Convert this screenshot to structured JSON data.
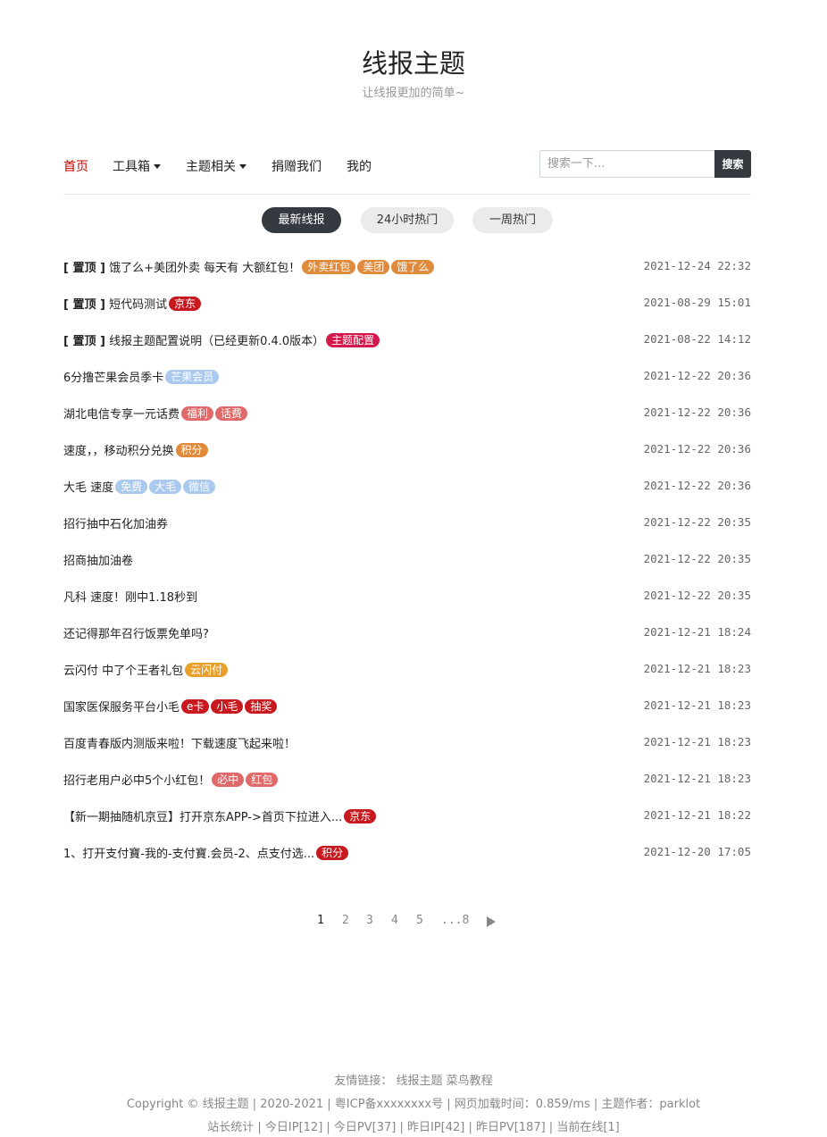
{
  "site": {
    "title": "线报主题",
    "subtitle": "让线报更加的简单~"
  },
  "nav": {
    "items": [
      {
        "label": "首页",
        "active": true,
        "dropdown": false
      },
      {
        "label": "工具箱",
        "active": false,
        "dropdown": true
      },
      {
        "label": "主题相关",
        "active": false,
        "dropdown": true
      },
      {
        "label": "捐赠我们",
        "active": false,
        "dropdown": false
      },
      {
        "label": "我的",
        "active": false,
        "dropdown": false
      }
    ],
    "search_placeholder": "搜索一下...",
    "search_button": "搜索"
  },
  "tabs": [
    {
      "label": "最新线报",
      "active": true
    },
    {
      "label": "24小时热门",
      "active": false
    },
    {
      "label": "一周热门",
      "active": false
    }
  ],
  "posts": [
    {
      "pin": "[ 置顶 ]",
      "title": "饿了么+美团外卖 每天有 大额红包！",
      "tags": [
        {
          "text": "外卖红包",
          "color": "#e08a3c"
        },
        {
          "text": "美团",
          "color": "#e08a3c"
        },
        {
          "text": "饿了么",
          "color": "#e08a3c"
        }
      ],
      "time": "2021-12-24 22:32"
    },
    {
      "pin": "[ 置顶 ]",
      "title": "短代码测试",
      "tags": [
        {
          "text": "京东",
          "color": "#c8191f"
        }
      ],
      "time": "2021-08-29 15:01"
    },
    {
      "pin": "[ 置顶 ]",
      "title": "线报主题配置说明（已经更新0.4.0版本）",
      "tags": [
        {
          "text": "主题配置",
          "color": "#d4174c"
        }
      ],
      "time": "2021-08-22 14:12"
    },
    {
      "pin": "",
      "title": "6分撸芒果会员季卡",
      "tags": [
        {
          "text": "芒果会员",
          "color": "#a9c9ef"
        }
      ],
      "time": "2021-12-22 20:36"
    },
    {
      "pin": "",
      "title": "湖北电信专享一元话费",
      "tags": [
        {
          "text": "福利",
          "color": "#e06a6a"
        },
        {
          "text": "话费",
          "color": "#e06a6a"
        }
      ],
      "time": "2021-12-22 20:36"
    },
    {
      "pin": "",
      "title": "速度，，移动积分兑换",
      "tags": [
        {
          "text": "积分",
          "color": "#e08a3c"
        }
      ],
      "time": "2021-12-22 20:36"
    },
    {
      "pin": "",
      "title": "大毛 速度",
      "tags": [
        {
          "text": "免费",
          "color": "#a9c9ef"
        },
        {
          "text": "大毛",
          "color": "#a9c9ef"
        },
        {
          "text": "微信",
          "color": "#a9c9ef"
        }
      ],
      "time": "2021-12-22 20:36"
    },
    {
      "pin": "",
      "title": "招行抽中石化加油券",
      "tags": [],
      "time": "2021-12-22 20:35"
    },
    {
      "pin": "",
      "title": "招商抽加油卷",
      "tags": [],
      "time": "2021-12-22 20:35"
    },
    {
      "pin": "",
      "title": "凡科 速度！刚中1.18秒到",
      "tags": [],
      "time": "2021-12-22 20:35"
    },
    {
      "pin": "",
      "title": "还记得那年召行饭票免单吗?",
      "tags": [],
      "time": "2021-12-21 18:24"
    },
    {
      "pin": "",
      "title": "云闪付 中了个王者礼包",
      "tags": [
        {
          "text": "云闪付",
          "color": "#e8a02c"
        }
      ],
      "time": "2021-12-21 18:23"
    },
    {
      "pin": "",
      "title": "国家医保服务平台小毛",
      "tags": [
        {
          "text": "e卡",
          "color": "#c8191f"
        },
        {
          "text": "小毛",
          "color": "#c8191f"
        },
        {
          "text": "抽奖",
          "color": "#c8191f"
        }
      ],
      "time": "2021-12-21 18:23"
    },
    {
      "pin": "",
      "title": "百度青春版内测版来啦！下载速度飞起来啦！",
      "tags": [],
      "time": "2021-12-21 18:23"
    },
    {
      "pin": "",
      "title": "招行老用户必中5个小红包！",
      "tags": [
        {
          "text": "必中",
          "color": "#e06a6a"
        },
        {
          "text": "红包",
          "color": "#e06a6a"
        }
      ],
      "time": "2021-12-21 18:23"
    },
    {
      "pin": "",
      "title": "【新一期抽随机京豆】打开京东APP->首页下拉进入...",
      "tags": [
        {
          "text": "京东",
          "color": "#c8191f"
        }
      ],
      "time": "2021-12-21 18:22"
    },
    {
      "pin": "",
      "title": "1、打开支付寶-我的-支付寶.会员-2、点支付选...",
      "tags": [
        {
          "text": "积分",
          "color": "#c8191f"
        }
      ],
      "time": "2021-12-20 17:05"
    }
  ],
  "pagination": {
    "pages": [
      "1",
      "2",
      "3",
      "4",
      "5",
      "...8"
    ],
    "current": "1"
  },
  "footer": {
    "links_label": "友情链接：",
    "links": [
      "线报主题",
      "菜鸟教程"
    ],
    "copyright": "Copyright © 线报主题 | 2020-2021 | 粤ICP备xxxxxxxx号 | 网页加载时间：0.859/ms | 主题作者：parklot",
    "stats": "站长统计 | 今日IP[12] | 今日PV[37] | 昨日IP[42] | 昨日PV[187] | 当前在线[1]"
  }
}
